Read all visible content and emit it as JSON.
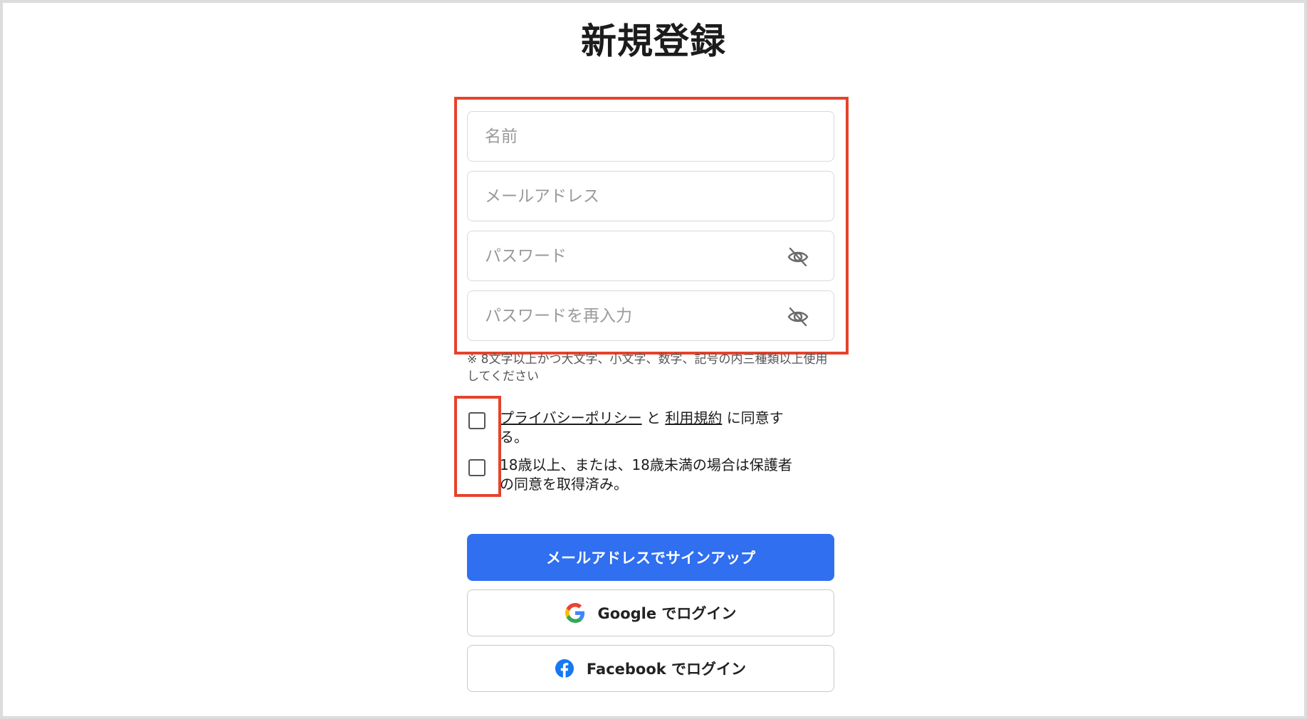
{
  "page": {
    "title": "新規登録"
  },
  "form": {
    "name_placeholder": "名前",
    "email_placeholder": "メールアドレス",
    "password_placeholder": "パスワード",
    "password_confirm_placeholder": "パスワードを再入力",
    "password_hint": "※ 8文字以上かつ大文字、小文字、数字、記号の内三種類以上使用してください"
  },
  "agreements": {
    "privacy_link": "プライバシーポリシー",
    "and": "と",
    "terms_link": "利用規約",
    "agree_suffix": "に同意する。",
    "age_text": "18歳以上、または、18歳未満の場合は保護者の同意を取得済み。"
  },
  "buttons": {
    "email_signup": "メールアドレスでサインアップ",
    "google_login": "Google でログイン",
    "facebook_login": "Facebook でログイン"
  },
  "icons": {
    "password_toggle": "eye-off-icon",
    "google": "google-icon",
    "facebook": "facebook-icon"
  },
  "colors": {
    "primary": "#2f6ff0",
    "highlight": "#e5432c",
    "facebook": "#1877f2"
  }
}
